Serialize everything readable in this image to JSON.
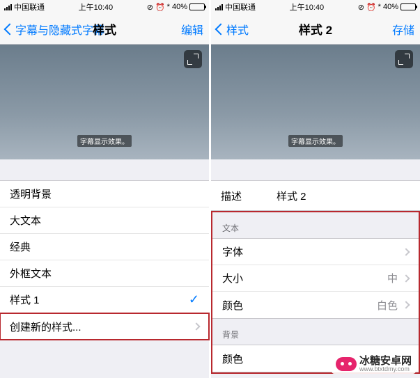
{
  "status": {
    "carrier": "中国联通",
    "time": "上午10:40",
    "battery_pct": "40%"
  },
  "left": {
    "back": "字幕与隐藏式字幕",
    "title": "样式",
    "edit": "编辑",
    "caption": "字幕显示效果。",
    "styles": [
      {
        "label": "透明背景"
      },
      {
        "label": "大文本"
      },
      {
        "label": "经典"
      },
      {
        "label": "外框文本"
      },
      {
        "label": "样式 1",
        "checked": true
      },
      {
        "label": "创建新的样式...",
        "disclosure": true,
        "highlight": true
      }
    ]
  },
  "right": {
    "back": "样式",
    "title": "样式 2",
    "save": "存储",
    "caption": "字幕显示效果。",
    "desc_label": "描述",
    "desc_value": "样式 2",
    "section_text": "文本",
    "text_rows": [
      {
        "label": "字体",
        "value": ""
      },
      {
        "label": "大小",
        "value": "中"
      },
      {
        "label": "颜色",
        "value": "白色"
      }
    ],
    "section_bg": "背景",
    "bg_rows": [
      {
        "label": "颜色",
        "value": ""
      }
    ]
  },
  "watermark": "冰糖安卓网",
  "watermark_url": "www.btxtdmy.com"
}
